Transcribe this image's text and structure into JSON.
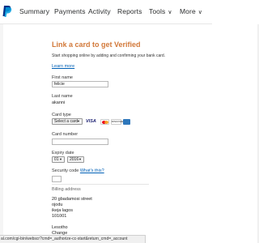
{
  "nav": {
    "items": [
      "Summary",
      "Payments",
      "Activity",
      "Reports",
      "Tools",
      "More"
    ],
    "tools_chevron": "∨",
    "more_chevron": "∨"
  },
  "form": {
    "heading": "Link a card to get Verified",
    "subtext": "Start shopping online by adding and confirming your bank card.",
    "learn_more": "Learn more",
    "first_name_label": "First name",
    "first_name_value": "felicie",
    "last_name_label": "Last name",
    "last_name_value": "akanni",
    "card_type_label": "Card type",
    "card_type_selected": "Select a card",
    "card_logos": [
      "visa-logo",
      "mastercard-logo",
      "discover-logo",
      "amex-logo"
    ],
    "visa_text": "VISA",
    "discover_text": "DISCOVER",
    "card_number_label": "Card number",
    "card_number_value": "",
    "expiry_label": "Expiry date",
    "expiry_month": "01",
    "expiry_year": "2016",
    "security_label": "Security code",
    "security_link": "What's this?",
    "billing_label": "Billing address",
    "billing_lines": [
      "20 gbadamosi street",
      "ojodu",
      "ikeja  lagos",
      "101001",
      "Lesotho",
      "Change"
    ]
  },
  "status_bar": {
    "url": "al.com/cgi-bin/webscr?cmd=_authorize-cc-start&return_cmd=_account"
  },
  "colors": {
    "heading": "#d2793a",
    "link": "#0060b6",
    "paypal_dark": "#003087",
    "paypal_light": "#009cde"
  }
}
